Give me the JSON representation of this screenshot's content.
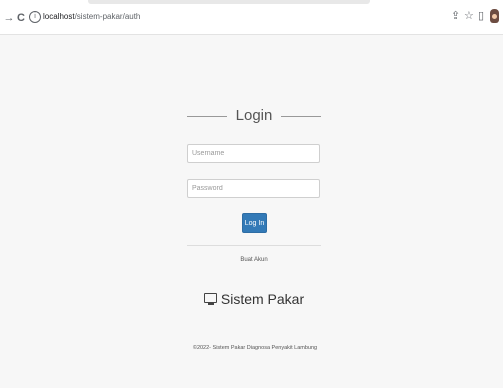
{
  "browser": {
    "url_host": "localhost",
    "url_path": "/sistem-pakar/auth",
    "back_glyph": "→",
    "reload_glyph": "C",
    "info_glyph": "i",
    "share_glyph": "⇪",
    "star_glyph": "☆",
    "sidebar_glyph": "▯"
  },
  "login": {
    "title": "Login",
    "username_placeholder": "Username",
    "password_placeholder": "Password",
    "login_button": "Log In",
    "register_link": "Buat Akun"
  },
  "brand": {
    "name": "Sistem Pakar",
    "icon": "monitor-icon"
  },
  "footer": {
    "text": "©2022- Sistem Pakar Diagnosa Penyakit Lambung"
  },
  "colors": {
    "primary_button": "#337ab7",
    "background": "#f7f7f7"
  }
}
